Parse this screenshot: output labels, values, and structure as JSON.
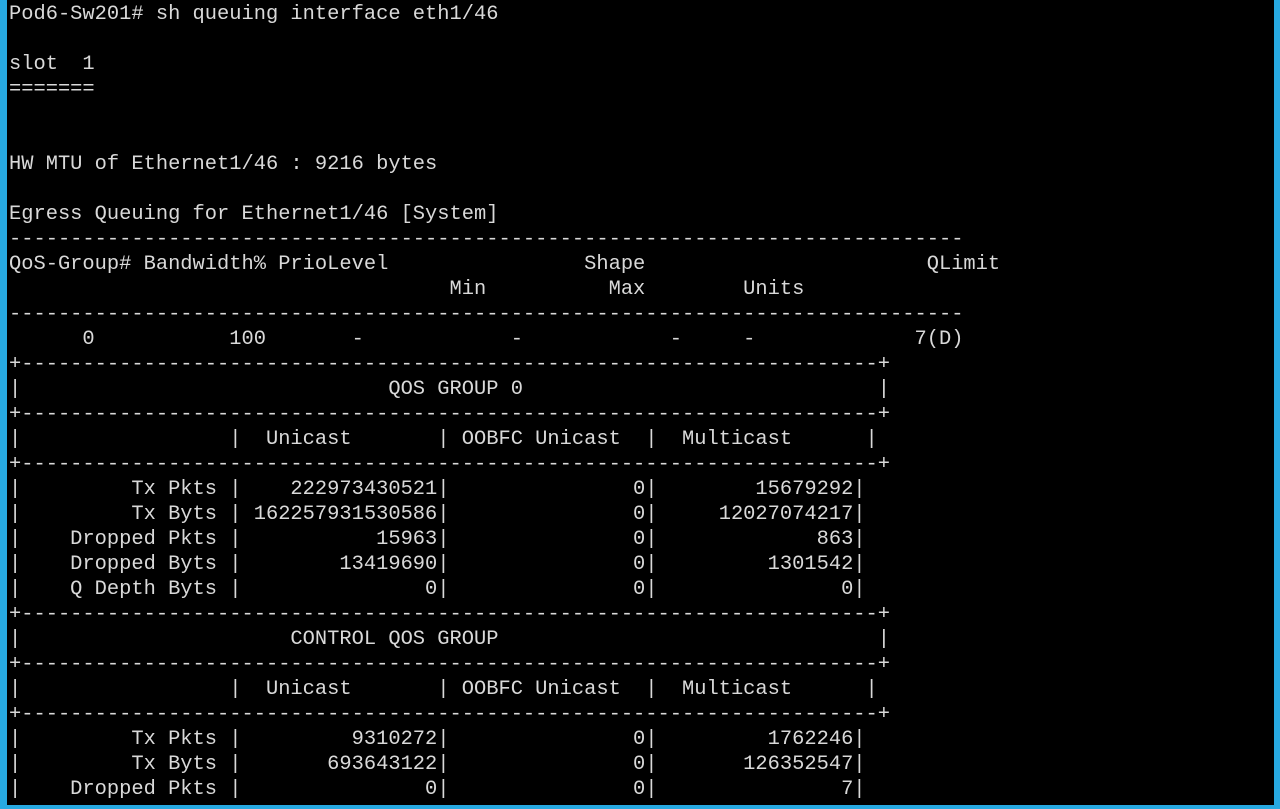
{
  "terminal": {
    "lines": [
      "Pod6-Sw201# sh queuing interface eth1/46",
      "",
      "slot  1",
      "=======",
      "",
      "",
      "HW MTU of Ethernet1/46 : 9216 bytes",
      "",
      "Egress Queuing for Ethernet1/46 [System]",
      "------------------------------------------------------------------------------",
      "QoS-Group# Bandwidth% PrioLevel                Shape                       QLimit",
      "                                    Min          Max        Units",
      "------------------------------------------------------------------------------",
      "      0           100       -            -            -     -             7(D)",
      "+----------------------------------------------------------------------+",
      "|                              QOS GROUP 0                             |",
      "+----------------------------------------------------------------------+",
      "|                 |  Unicast       | OOBFC Unicast  |  Multicast      |",
      "+----------------------------------------------------------------------+",
      "|         Tx Pkts |    222973430521|               0|        15679292|",
      "|         Tx Byts | 162257931530586|               0|     12027074217|",
      "|    Dropped Pkts |           15963|               0|             863|",
      "|    Dropped Byts |        13419690|               0|         1301542|",
      "|    Q Depth Byts |               0|               0|               0|",
      "+----------------------------------------------------------------------+",
      "|                      CONTROL QOS GROUP                               |",
      "+----------------------------------------------------------------------+",
      "|                 |  Unicast       | OOBFC Unicast  |  Multicast      |",
      "+----------------------------------------------------------------------+",
      "|         Tx Pkts |         9310272|               0|         1762246|",
      "|         Tx Byts |       693643122|               0|       126352547|",
      "|    Dropped Pkts |               0|               0|               7|"
    ]
  },
  "colors": {
    "background": "#000000",
    "text": "#d9d9d9",
    "window_border": "#27a9e1"
  }
}
